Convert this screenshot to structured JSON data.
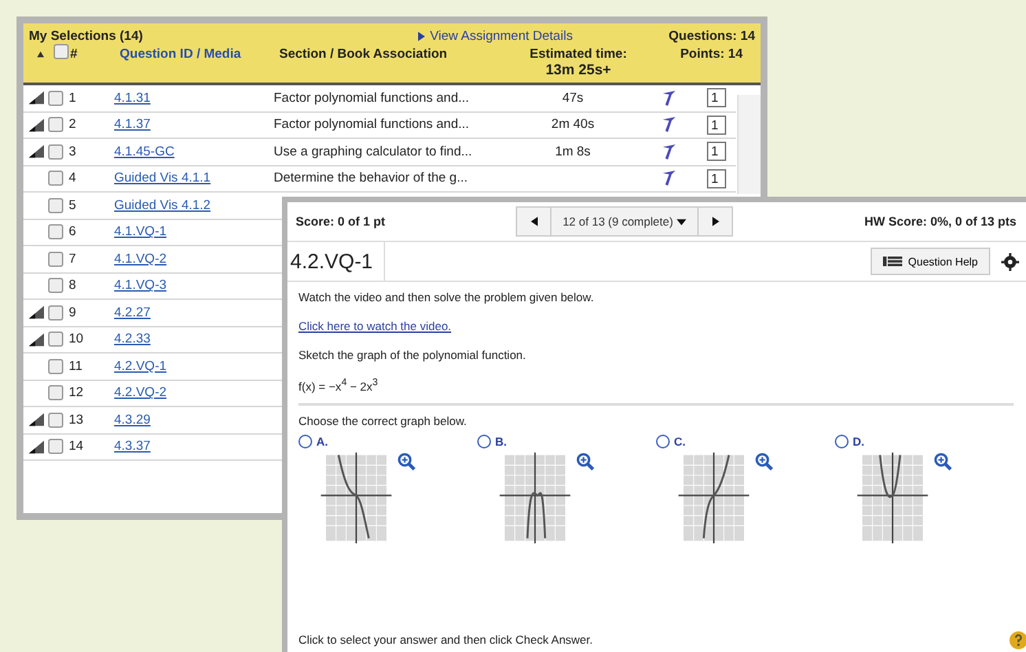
{
  "selections": {
    "title": "My Selections (14)",
    "details_link": "View Assignment Details",
    "questions": "Questions: 14",
    "points": "Points: 14",
    "select_all_checked": false,
    "columns": {
      "number": "#",
      "id": "Question ID / Media",
      "section": "Section / Book Association",
      "time": "Estimated time:",
      "time_total": "13m 25s+"
    },
    "rows": [
      {
        "number": "1",
        "id": "4.1.31",
        "section": "Factor polynomial functions and...",
        "time": "47s",
        "media": true,
        "checked": false,
        "points": "1"
      },
      {
        "number": "2",
        "id": "4.1.37",
        "section": "Factor polynomial functions and...",
        "time": "2m 40s",
        "media": true,
        "checked": false,
        "points": "1"
      },
      {
        "number": "3",
        "id": "4.1.45-GC",
        "section": "Use a graphing calculator to find...",
        "time": "1m 8s",
        "media": true,
        "checked": false,
        "points": "1"
      },
      {
        "number": "4",
        "id": "Guided Vis 4.1.1",
        "section": "Determine the behavior of the g...",
        "media": false,
        "checked": false,
        "points": "1"
      },
      {
        "number": "5",
        "id": "Guided Vis 4.1.2",
        "media": false,
        "checked": false
      },
      {
        "number": "6",
        "id": "4.1.VQ-1",
        "media": false,
        "checked": false
      },
      {
        "number": "7",
        "id": "4.1.VQ-2",
        "media": false,
        "checked": false
      },
      {
        "number": "8",
        "id": "4.1.VQ-3",
        "media": false,
        "checked": false
      },
      {
        "number": "9",
        "id": "4.2.27",
        "media": true,
        "checked": false
      },
      {
        "number": "10",
        "id": "4.2.33",
        "media": true,
        "checked": false
      },
      {
        "number": "11",
        "id": "4.2.VQ-1",
        "media": false,
        "checked": false
      },
      {
        "number": "12",
        "id": "4.2.VQ-2",
        "media": false,
        "checked": false
      },
      {
        "number": "13",
        "id": "4.3.29",
        "media": true,
        "checked": false
      },
      {
        "number": "14",
        "id": "4.3.37",
        "media": true,
        "checked": false
      }
    ]
  },
  "question": {
    "score": "Score: 0 of 1 pt",
    "nav": "12 of 13 (9 complete)",
    "hw_score": "HW Score: 0%, 0 of 13 pts",
    "title": "4.2.VQ-1",
    "help_button": "Question Help",
    "lines": [
      {
        "kind": "text",
        "text": "Watch the video and then solve the problem given below."
      },
      {
        "kind": "link",
        "text": "Click here to watch the video."
      },
      {
        "kind": "text",
        "text": "Sketch the graph of the polynomial function."
      },
      {
        "kind": "text",
        "text": "f(x) = −x$^{4}$ − 2x$^{3}$"
      }
    ],
    "prompt": "Choose the correct graph below.",
    "options": [
      {
        "label": "A.",
        "selected": false
      },
      {
        "label": "B.",
        "selected": false
      },
      {
        "label": "C.",
        "selected": false
      },
      {
        "label": "D.",
        "selected": false
      }
    ],
    "footer": "Click to select your answer and then click Check Answer."
  }
}
